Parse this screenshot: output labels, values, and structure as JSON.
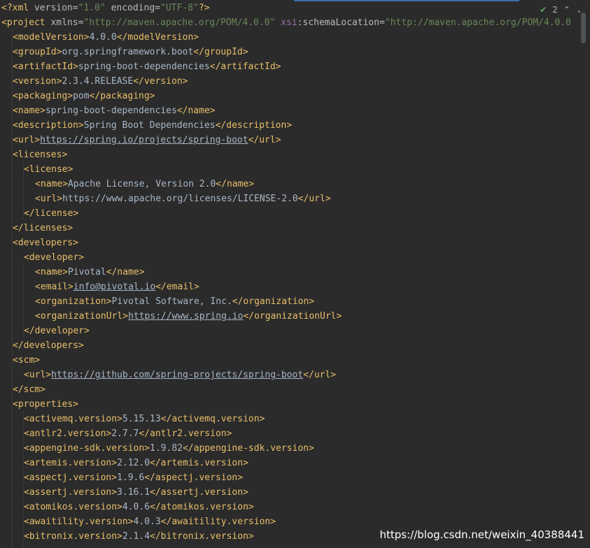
{
  "window_indicator": {
    "check_count": "2"
  },
  "editor": {
    "lines": [
      {
        "indent": 0,
        "segs": [
          [
            "pi",
            "<?xml "
          ],
          [
            "attr",
            "version="
          ],
          [
            "str",
            "\"1.0\" "
          ],
          [
            "attr",
            "encoding="
          ],
          [
            "str",
            "\"UTF-8\""
          ],
          [
            "pi",
            "?>"
          ]
        ]
      },
      {
        "indent": 0,
        "segs": [
          [
            "tag",
            "<project "
          ],
          [
            "attr",
            "xmlns="
          ],
          [
            "str",
            "\"http://maven.apache.org/POM/4.0.0\" "
          ],
          [
            "ns",
            "xsi"
          ],
          [
            "attr",
            ":schemaLocation="
          ],
          [
            "str",
            "\"http://maven.apache.org/POM/4.0.0"
          ]
        ]
      },
      {
        "indent": 1,
        "segs": [
          [
            "tag",
            "<modelVersion>"
          ],
          [
            "text",
            "4.0.0"
          ],
          [
            "tag",
            "</modelVersion>"
          ]
        ]
      },
      {
        "indent": 1,
        "segs": [
          [
            "tag",
            "<groupId>"
          ],
          [
            "text",
            "org.springframework.boot"
          ],
          [
            "tag",
            "</groupId>"
          ]
        ]
      },
      {
        "indent": 1,
        "segs": [
          [
            "tag",
            "<artifactId>"
          ],
          [
            "text",
            "spring-boot-dependencies"
          ],
          [
            "tag",
            "</artifactId>"
          ]
        ]
      },
      {
        "indent": 1,
        "segs": [
          [
            "tag",
            "<version>"
          ],
          [
            "text",
            "2.3.4.RELEASE"
          ],
          [
            "tag",
            "</version>"
          ]
        ]
      },
      {
        "indent": 1,
        "segs": [
          [
            "tag",
            "<packaging>"
          ],
          [
            "text",
            "pom"
          ],
          [
            "tag",
            "</packaging>"
          ]
        ]
      },
      {
        "indent": 1,
        "segs": [
          [
            "tag",
            "<name>"
          ],
          [
            "text",
            "spring-boot-dependencies"
          ],
          [
            "tag",
            "</name>"
          ]
        ]
      },
      {
        "indent": 1,
        "segs": [
          [
            "tag",
            "<description>"
          ],
          [
            "text",
            "Spring Boot Dependencies"
          ],
          [
            "tag",
            "</description>"
          ]
        ]
      },
      {
        "indent": 1,
        "segs": [
          [
            "tag",
            "<url>"
          ],
          [
            "link",
            "https://spring.io/projects/spring-boot"
          ],
          [
            "tag",
            "</url>"
          ]
        ]
      },
      {
        "indent": 1,
        "segs": [
          [
            "tag",
            "<licenses>"
          ]
        ]
      },
      {
        "indent": 2,
        "segs": [
          [
            "tag",
            "<license>"
          ]
        ]
      },
      {
        "indent": 3,
        "segs": [
          [
            "tag",
            "<name>"
          ],
          [
            "text",
            "Apache License, Version 2.0"
          ],
          [
            "tag",
            "</name>"
          ]
        ]
      },
      {
        "indent": 3,
        "segs": [
          [
            "tag",
            "<url>"
          ],
          [
            "text",
            "https://www.apache.org/licenses/LICENSE-2.0"
          ],
          [
            "tag",
            "</url>"
          ]
        ]
      },
      {
        "indent": 2,
        "segs": [
          [
            "tag",
            "</license>"
          ]
        ]
      },
      {
        "indent": 1,
        "segs": [
          [
            "tag",
            "</licenses>"
          ]
        ]
      },
      {
        "indent": 1,
        "segs": [
          [
            "tag",
            "<developers>"
          ]
        ]
      },
      {
        "indent": 2,
        "segs": [
          [
            "tag",
            "<developer>"
          ]
        ]
      },
      {
        "indent": 3,
        "segs": [
          [
            "tag",
            "<name>"
          ],
          [
            "text",
            "Pivotal"
          ],
          [
            "tag",
            "</name>"
          ]
        ]
      },
      {
        "indent": 3,
        "segs": [
          [
            "tag",
            "<email>"
          ],
          [
            "link",
            "info@pivotal.io"
          ],
          [
            "tag",
            "</email>"
          ]
        ]
      },
      {
        "indent": 3,
        "segs": [
          [
            "tag",
            "<organization>"
          ],
          [
            "text",
            "Pivotal Software, Inc."
          ],
          [
            "tag",
            "</organization>"
          ]
        ]
      },
      {
        "indent": 3,
        "segs": [
          [
            "tag",
            "<organizationUrl>"
          ],
          [
            "link",
            "https://www.spring.io"
          ],
          [
            "tag",
            "</organizationUrl>"
          ]
        ]
      },
      {
        "indent": 2,
        "segs": [
          [
            "tag",
            "</developer>"
          ]
        ]
      },
      {
        "indent": 1,
        "segs": [
          [
            "tag",
            "</developers>"
          ]
        ]
      },
      {
        "indent": 1,
        "segs": [
          [
            "tag",
            "<scm>"
          ]
        ]
      },
      {
        "indent": 2,
        "segs": [
          [
            "tag",
            "<url>"
          ],
          [
            "link",
            "https://github.com/spring-projects/spring-boot"
          ],
          [
            "tag",
            "</url>"
          ]
        ]
      },
      {
        "indent": 1,
        "segs": [
          [
            "tag",
            "</scm>"
          ]
        ]
      },
      {
        "indent": 1,
        "segs": [
          [
            "tag",
            "<properties>"
          ]
        ]
      },
      {
        "indent": 2,
        "segs": [
          [
            "tag",
            "<activemq.version>"
          ],
          [
            "text",
            "5.15.13"
          ],
          [
            "tag",
            "</activemq.version>"
          ]
        ]
      },
      {
        "indent": 2,
        "segs": [
          [
            "tag",
            "<antlr2.version>"
          ],
          [
            "text",
            "2.7.7"
          ],
          [
            "tag",
            "</antlr2.version>"
          ]
        ]
      },
      {
        "indent": 2,
        "segs": [
          [
            "tag",
            "<appengine-sdk.version>"
          ],
          [
            "text",
            "1.9.82"
          ],
          [
            "tag",
            "</appengine-sdk.version>"
          ]
        ]
      },
      {
        "indent": 2,
        "segs": [
          [
            "tag",
            "<artemis.version>"
          ],
          [
            "text",
            "2.12.0"
          ],
          [
            "tag",
            "</artemis.version>"
          ]
        ]
      },
      {
        "indent": 2,
        "segs": [
          [
            "tag",
            "<aspectj.version>"
          ],
          [
            "text",
            "1.9.6"
          ],
          [
            "tag",
            "</aspectj.version>"
          ]
        ]
      },
      {
        "indent": 2,
        "segs": [
          [
            "tag",
            "<assertj.version>"
          ],
          [
            "text",
            "3.16.1"
          ],
          [
            "tag",
            "</assertj.version>"
          ]
        ]
      },
      {
        "indent": 2,
        "segs": [
          [
            "tag",
            "<atomikos.version>"
          ],
          [
            "text",
            "4.0.6"
          ],
          [
            "tag",
            "</atomikos.version>"
          ]
        ]
      },
      {
        "indent": 2,
        "segs": [
          [
            "tag",
            "<awaitility.version>"
          ],
          [
            "text",
            "4.0.3"
          ],
          [
            "tag",
            "</awaitility.version>"
          ]
        ]
      },
      {
        "indent": 2,
        "segs": [
          [
            "tag",
            "<bitronix.version>"
          ],
          [
            "text",
            "2.1.4"
          ],
          [
            "tag",
            "</bitronix.version>"
          ]
        ]
      }
    ]
  },
  "watermark": "https://blog.csdn.net/weixin_40388441"
}
